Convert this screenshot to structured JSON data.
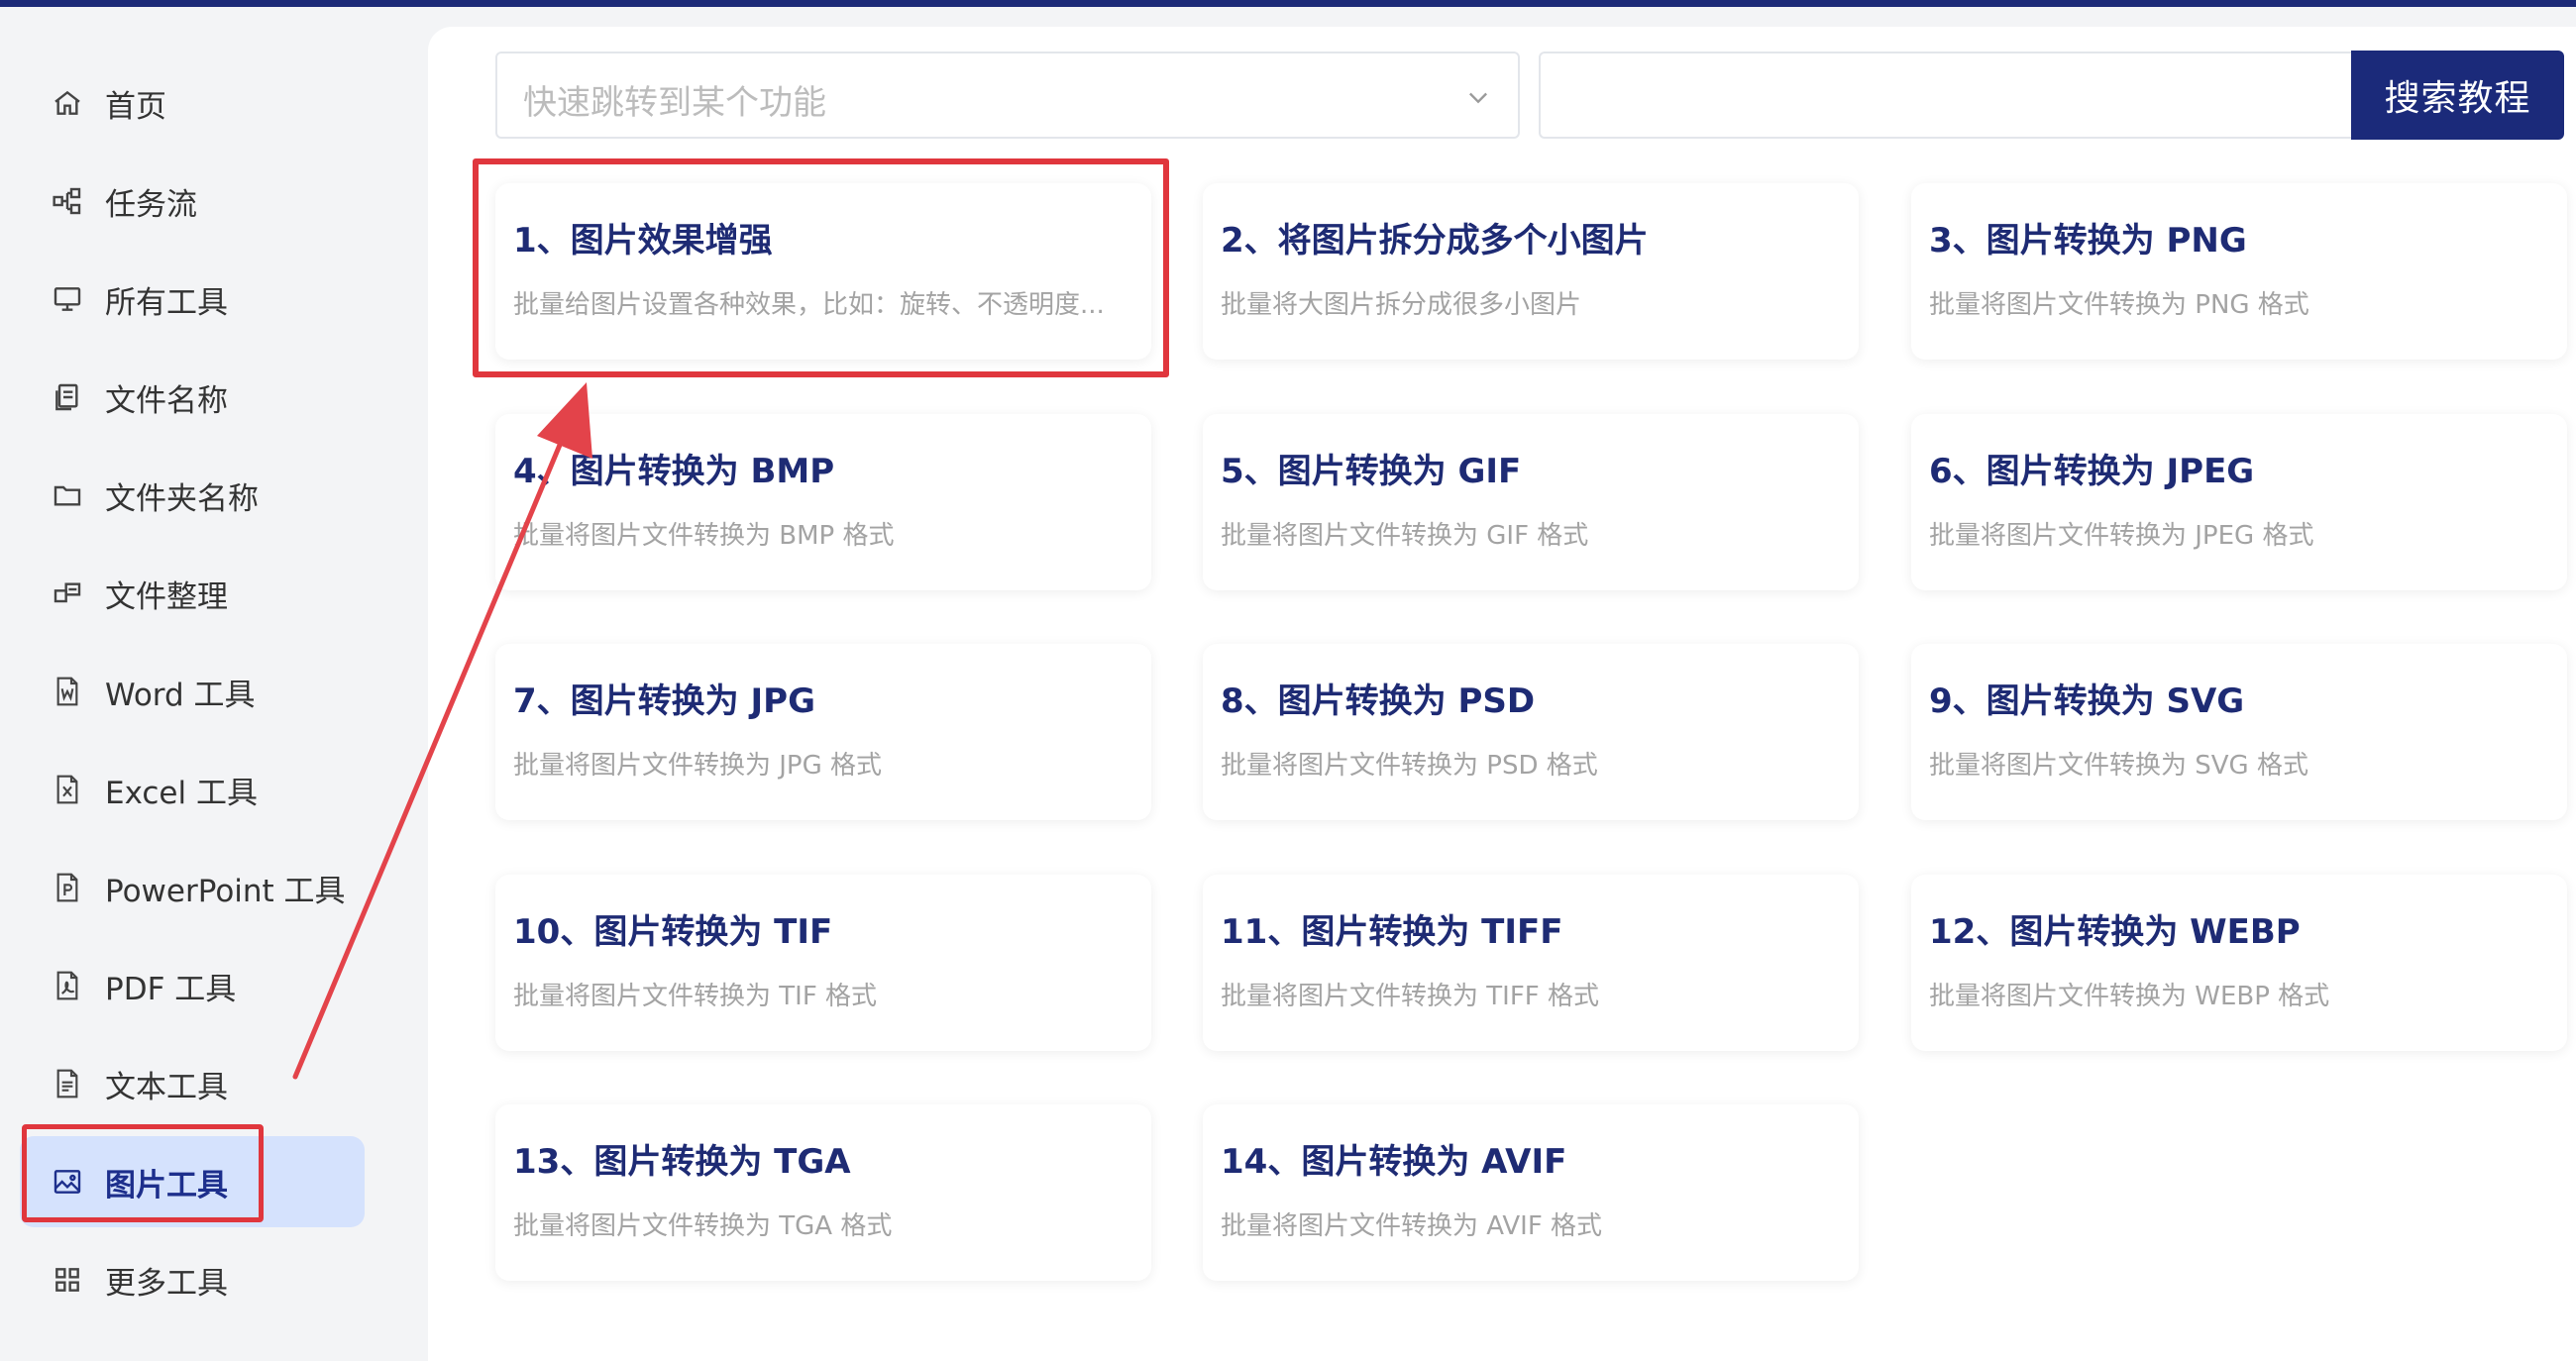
{
  "sidebar": {
    "items": [
      {
        "label": "首页",
        "icon": "home-icon"
      },
      {
        "label": "任务流",
        "icon": "workflow-icon"
      },
      {
        "label": "所有工具",
        "icon": "monitor-icon"
      },
      {
        "label": "文件名称",
        "icon": "file-copy-icon"
      },
      {
        "label": "文件夹名称",
        "icon": "folder-icon"
      },
      {
        "label": "文件整理",
        "icon": "organize-icon"
      },
      {
        "label": "Word 工具",
        "icon": "word-file-icon"
      },
      {
        "label": "Excel 工具",
        "icon": "excel-file-icon"
      },
      {
        "label": "PowerPoint 工具",
        "icon": "powerpoint-file-icon"
      },
      {
        "label": "PDF 工具",
        "icon": "pdf-file-icon"
      },
      {
        "label": "文本工具",
        "icon": "text-file-icon"
      },
      {
        "label": "图片工具",
        "icon": "image-icon",
        "active": true
      },
      {
        "label": "更多工具",
        "icon": "grid-icon"
      }
    ]
  },
  "toolbar": {
    "quick_jump_placeholder": "快速跳转到某个功能",
    "search_value": "",
    "search_button_label": "搜索教程"
  },
  "cards": [
    {
      "title": "1、图片效果增强",
      "desc": "批量给图片设置各种效果，比如：旋转、不透明度..."
    },
    {
      "title": "2、将图片拆分成多个小图片",
      "desc": "批量将大图片拆分成很多小图片"
    },
    {
      "title": "3、图片转换为 PNG",
      "desc": "批量将图片文件转换为 PNG 格式"
    },
    {
      "title": "4、图片转换为 BMP",
      "desc": "批量将图片文件转换为 BMP 格式"
    },
    {
      "title": "5、图片转换为 GIF",
      "desc": "批量将图片文件转换为 GIF 格式"
    },
    {
      "title": "6、图片转换为 JPEG",
      "desc": "批量将图片文件转换为 JPEG 格式"
    },
    {
      "title": "7、图片转换为 JPG",
      "desc": "批量将图片文件转换为 JPG 格式"
    },
    {
      "title": "8、图片转换为 PSD",
      "desc": "批量将图片文件转换为 PSD 格式"
    },
    {
      "title": "9、图片转换为 SVG",
      "desc": "批量将图片文件转换为 SVG 格式"
    },
    {
      "title": "10、图片转换为 TIF",
      "desc": "批量将图片文件转换为 TIF 格式"
    },
    {
      "title": "11、图片转换为 TIFF",
      "desc": "批量将图片文件转换为 TIFF 格式"
    },
    {
      "title": "12、图片转换为 WEBP",
      "desc": "批量将图片文件转换为 WEBP 格式"
    },
    {
      "title": "13、图片转换为 TGA",
      "desc": "批量将图片文件转换为 TGA 格式"
    },
    {
      "title": "14、图片转换为 AVIF",
      "desc": "批量将图片文件转换为 AVIF 格式"
    }
  ],
  "colors": {
    "brand": "#1b2a7a",
    "card_title": "#1e2b74",
    "highlight": "#e0363d",
    "active_bg": "#d5e2fd"
  }
}
